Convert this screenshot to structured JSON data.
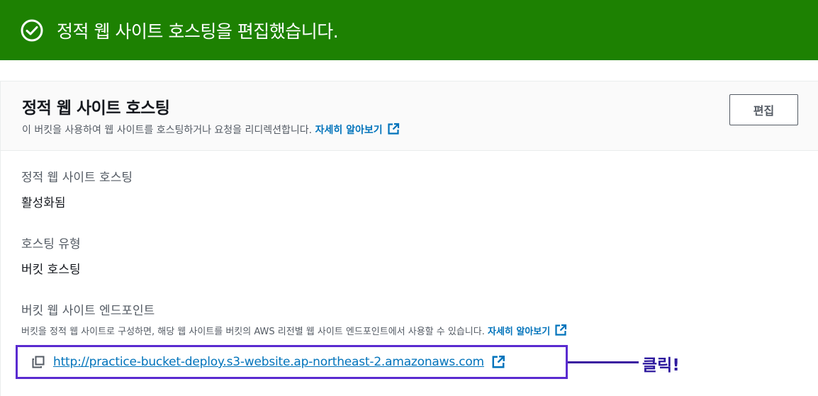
{
  "banner": {
    "message": "정적 웹 사이트 호스팅을 편집했습니다.",
    "icon": "check-circle-icon",
    "color": "#1d8102"
  },
  "panel": {
    "title": "정적 웹 사이트 호스팅",
    "description": "이 버킷을 사용하여 웹 사이트를 호스팅하거나 요청을 리디렉션합니다.",
    "learn_more": "자세히 알아보기",
    "edit_button": "편집"
  },
  "fields": {
    "hosting_label": "정적 웹 사이트 호스팅",
    "hosting_value": "활성화됨",
    "type_label": "호스팅 유형",
    "type_value": "버킷 호스팅",
    "endpoint_label": "버킷 웹 사이트 엔드포인트",
    "endpoint_desc": "버킷을 정적 웹 사이트로 구성하면, 해당 웹 사이트를 버킷의 AWS 리전별 웹 사이트 엔드포인트에서 사용할 수 있습니다.",
    "endpoint_learn_more": "자세히 알아보기",
    "endpoint_url": "http://practice-bucket-deploy.s3-website.ap-northeast-2.amazonaws.com"
  },
  "annotation": {
    "text": "클릭!",
    "color": "#5a2bd0"
  }
}
